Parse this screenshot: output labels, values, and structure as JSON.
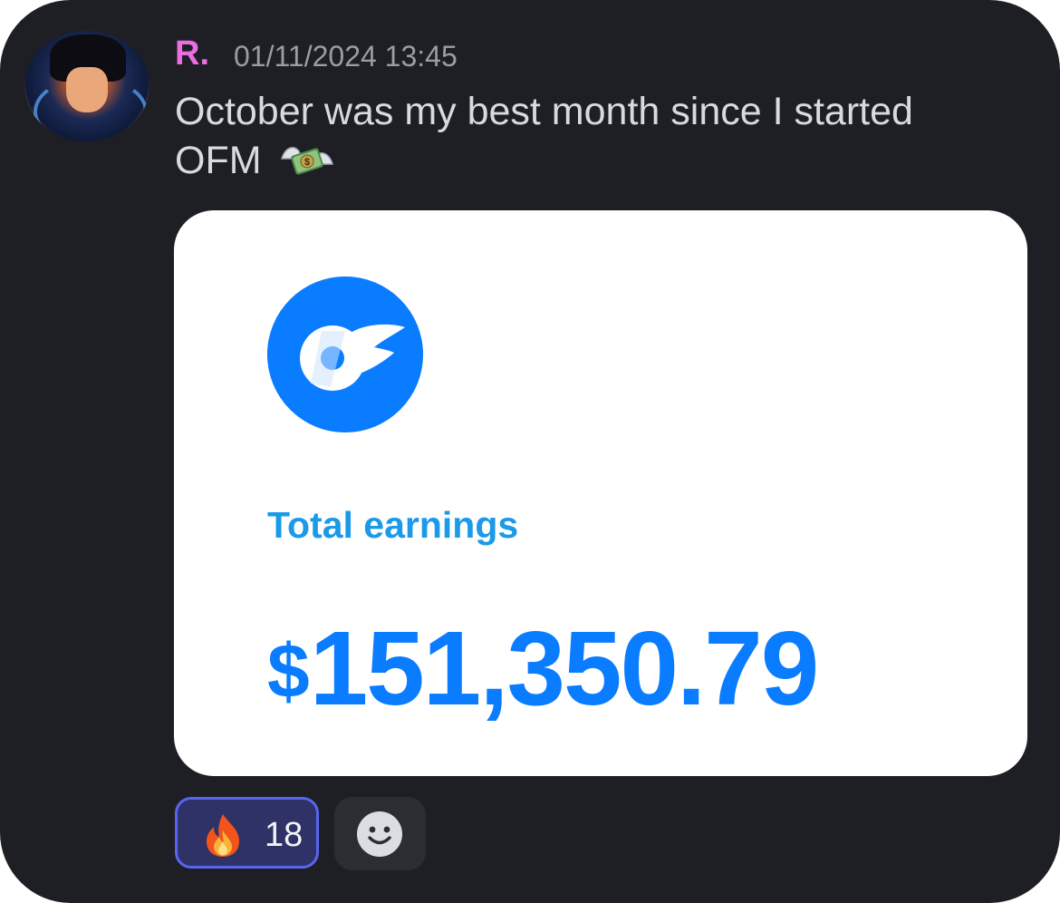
{
  "message": {
    "author": "R.",
    "timestamp": "01/11/2024 13:45",
    "text": "October was my best month since I started OFM",
    "text_emoji": "money-with-wings",
    "author_color": "#ea6ee0"
  },
  "embed": {
    "logo": "onlyfans-logo",
    "label": "Total earnings",
    "amount_symbol": "$",
    "amount_value": "151,350.79",
    "accent_color": "#0a7cff"
  },
  "reactions": [
    {
      "emoji": "fire",
      "count": "18",
      "selected": true
    }
  ],
  "add_reaction": {
    "icon": "smiley-add-icon"
  }
}
